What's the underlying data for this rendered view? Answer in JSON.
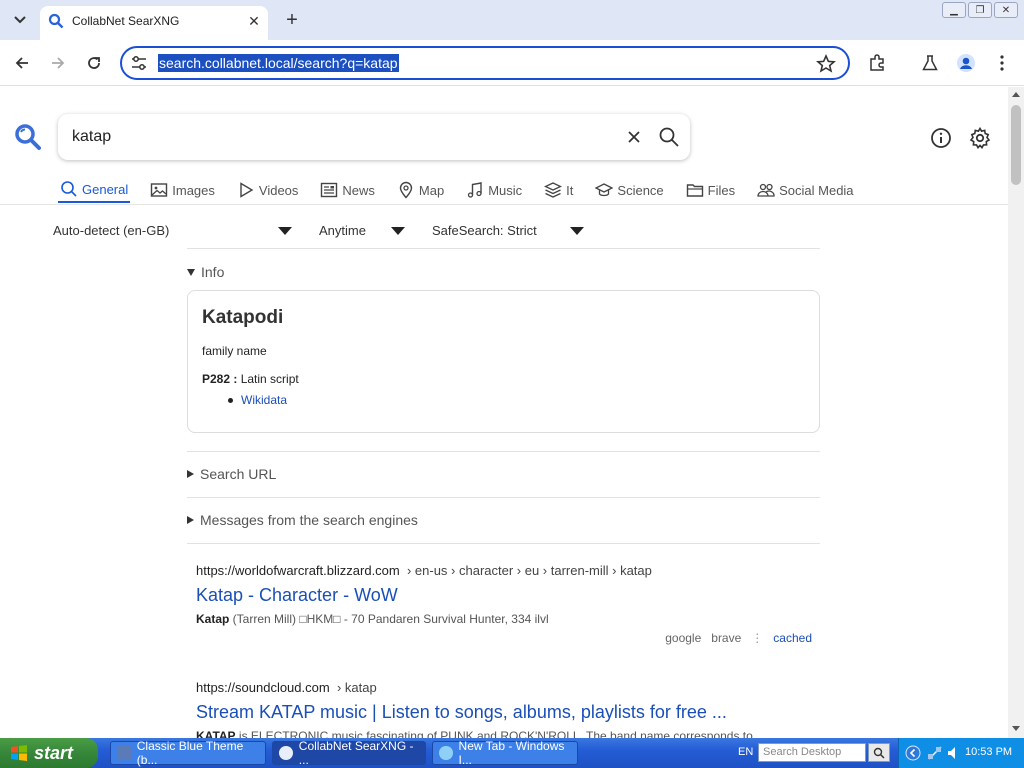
{
  "browser": {
    "tab_title": "CollabNet SearXNG",
    "url": "search.collabnet.local/search?q=katap"
  },
  "search": {
    "query": "katap",
    "categories": [
      {
        "label": "General",
        "icon": "search-icon",
        "active": true
      },
      {
        "label": "Images",
        "icon": "image-icon"
      },
      {
        "label": "Videos",
        "icon": "play-icon"
      },
      {
        "label": "News",
        "icon": "newspaper-icon"
      },
      {
        "label": "Map",
        "icon": "map-pin-icon"
      },
      {
        "label": "Music",
        "icon": "music-note-icon"
      },
      {
        "label": "It",
        "icon": "layers-icon"
      },
      {
        "label": "Science",
        "icon": "graduation-cap-icon"
      },
      {
        "label": "Files",
        "icon": "folder-icon"
      },
      {
        "label": "Social Media",
        "icon": "people-icon"
      }
    ],
    "filters": {
      "language": "Auto-detect (en-GB)",
      "time": "Anytime",
      "safesearch": "SafeSearch: Strict"
    }
  },
  "info": {
    "section_label": "Info",
    "title": "Katapodi",
    "description": "family name",
    "attr_key": "P282 :",
    "attr_value": "Latin script",
    "link": "Wikidata"
  },
  "sections": {
    "search_url": "Search URL",
    "messages": "Messages from the search engines"
  },
  "results": [
    {
      "domain": "https://worldofwarcraft.blizzard.com",
      "path": "› en-us › character › eu › tarren-mill › katap",
      "title": "Katap - Character - WoW",
      "snippet_bold": "Katap",
      "snippet": " (Tarren Mill) □HKM□ - 70 Pandaren Survival Hunter, 334 ilvl",
      "engines": [
        "google",
        "brave"
      ],
      "cached": "cached"
    },
    {
      "domain": "https://soundcloud.com",
      "path": "› katap",
      "title": "Stream KATAP music | Listen to songs, albums, playlists for free ...",
      "snippet_bold": "KATAP",
      "snippet": " is ELECTRONIC music fascinating of PUNK and ROCK'N'ROLL. The band name corresponds to"
    }
  ],
  "taskbar": {
    "start": "start",
    "tasks": [
      {
        "label": "Classic Blue Theme (b...",
        "active": false
      },
      {
        "label": "CollabNet SearXNG - ...",
        "active": true
      },
      {
        "label": "New Tab - Windows I...",
        "active": false
      }
    ],
    "lang": "EN",
    "desktop_search": "Search Desktop",
    "clock": "10:53 PM"
  }
}
